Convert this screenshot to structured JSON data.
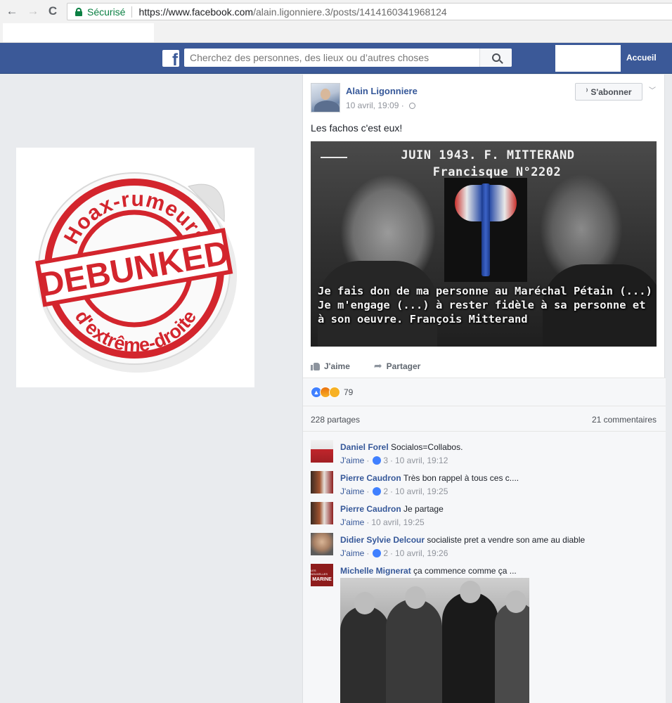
{
  "browser": {
    "secure_label": "Sécurisé",
    "url_host": "https://www.facebook.com",
    "url_path": "/alain.ligonniere.3/posts/1414160341968124",
    "back_glyph": "←",
    "forward_glyph": "→",
    "reload_glyph": "C"
  },
  "fb": {
    "logo": "f",
    "search_placeholder": "Cherchez des personnes, des lieux ou d’autres choses",
    "home_label": "Accueil"
  },
  "sticker": {
    "top_text": "Hoax-rumeurs",
    "center_text": "DEBUNKED",
    "bottom_text": "d'extrême-droite"
  },
  "post": {
    "author": "Alain Ligonniere",
    "timestamp": "10 avril, 19:09 ·",
    "subscribe_label": "S'abonner",
    "text": "Les fachos c'est eux!",
    "photo": {
      "title_line1": "JUIN 1943. F. MITTERAND",
      "title_line2": "Francisque N°2202",
      "quote": "Je fais don de ma personne au Maréchal Pétain (...) Je m'engage (...) à rester fidèle à sa personne et à son oeuvre. François Mitterand"
    },
    "like_label": "J'aime",
    "share_label": "Partager",
    "reaction_count": "79",
    "shares": "228 partages",
    "comments_count": "21 commentaires"
  },
  "comments": [
    {
      "name": "Daniel Forel",
      "text": "Socialos=Collabos.",
      "like": "J'aime",
      "likes": "3",
      "time": "10 avril, 19:12"
    },
    {
      "name": "Pierre Caudron",
      "text": "Très bon rappel à tous ces c....",
      "like": "J'aime",
      "likes": "2",
      "time": "10 avril, 19:25"
    },
    {
      "name": "Pierre Caudron",
      "text": "Je partage",
      "like": "J'aime",
      "likes": "",
      "time": "10 avril, 19:25"
    },
    {
      "name": "Didier Sylvie Delcour",
      "text": "socialiste pret a vendre son ame au diable",
      "like": "J'aime",
      "likes": "2",
      "time": "10 avril, 19:26"
    },
    {
      "name": "Michelle Mignerat",
      "text": "ça commence comme ça ...",
      "avatar_small": "LES NOUVELLES",
      "avatar_big": "MARINE"
    }
  ],
  "colors": {
    "fb_blue": "#3b5998",
    "link_blue": "#365899",
    "secure_green": "#0b8043",
    "sticker_red": "#d3252d"
  },
  "icons": [
    "back-arrow-icon",
    "forward-arrow-icon",
    "reload-icon",
    "lock-icon",
    "facebook-logo-icon",
    "search-icon",
    "rss-icon",
    "chevron-down-icon",
    "globe-icon",
    "thumbs-up-icon",
    "share-arrow-icon",
    "like-reaction-icon",
    "angry-reaction-icon",
    "haha-reaction-icon"
  ]
}
